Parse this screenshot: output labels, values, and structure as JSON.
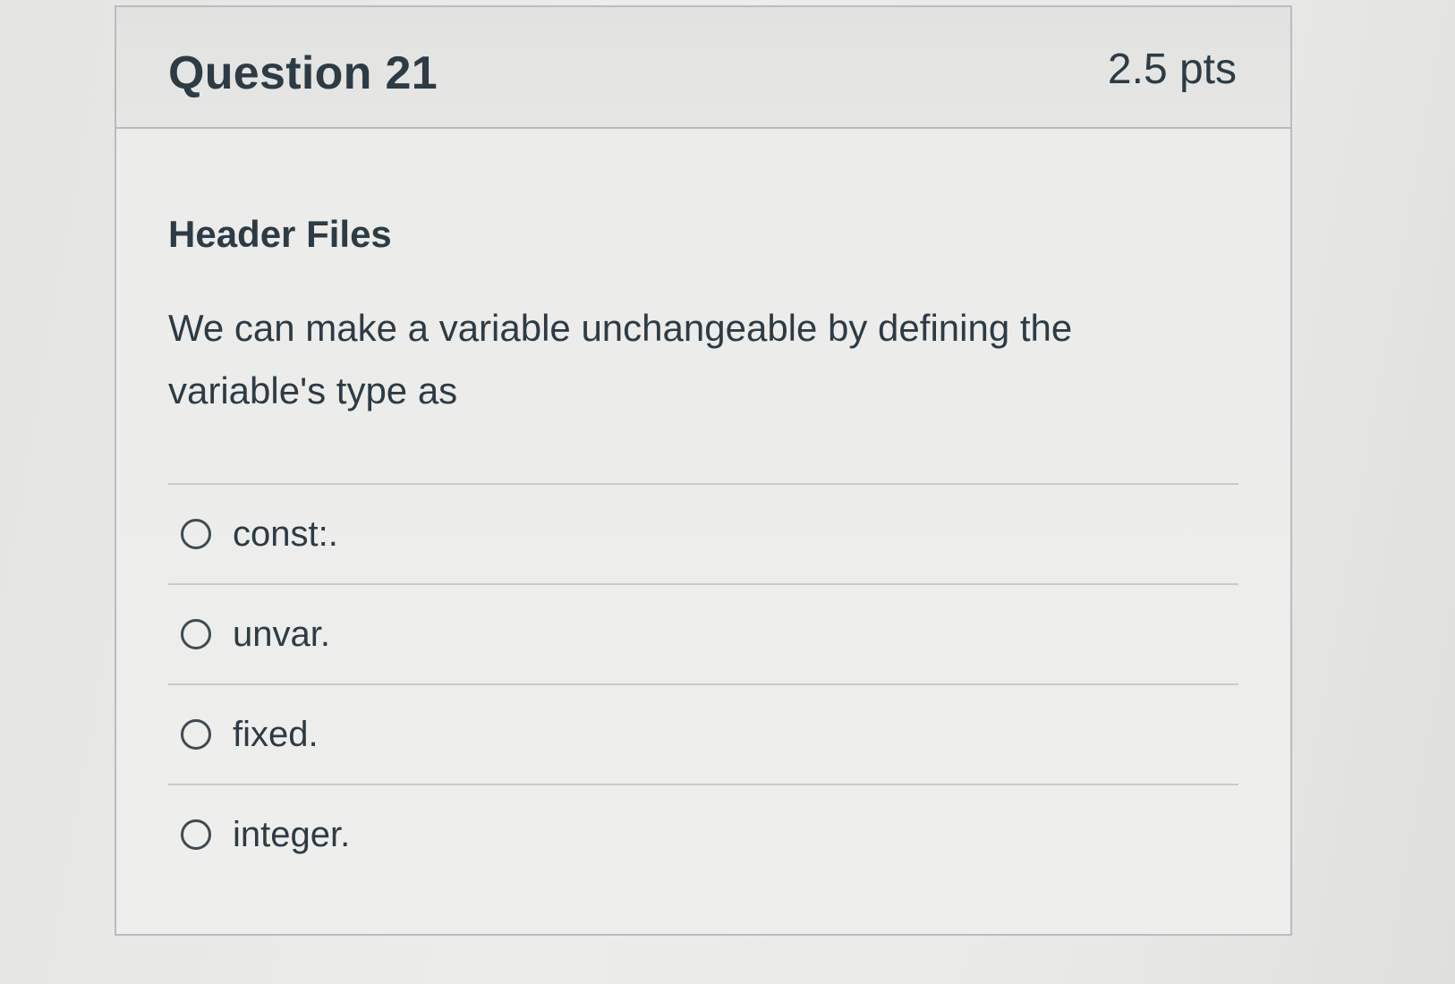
{
  "question": {
    "title": "Question 21",
    "points": "2.5 pts",
    "topic": "Header Files",
    "prompt": "We can make a variable unchangeable by defining the variable's type as",
    "answers": [
      {
        "label": "const:.",
        "selected": false
      },
      {
        "label": "unvar.",
        "selected": false
      },
      {
        "label": "fixed.",
        "selected": false
      },
      {
        "label": "integer.",
        "selected": false
      }
    ]
  },
  "colors": {
    "text": "#2d3b45",
    "border": "#b9bcbf",
    "header_bg": "#e2e2e0"
  }
}
